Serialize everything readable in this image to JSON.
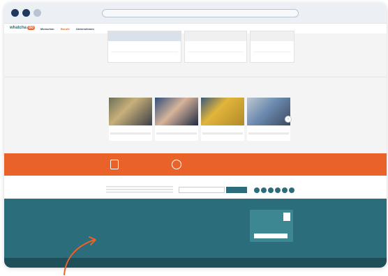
{
  "browser": {
    "url": ""
  },
  "nav": {
    "logo_text": "whatchado",
    "items": [
      "Menschen",
      "Berufe",
      "Unternehmen"
    ],
    "active_index": 1
  },
  "job_cards": [],
  "professions": {
    "title": "",
    "more_label": "",
    "cards": [
      {
        "name": ""
      },
      {
        "name": ""
      },
      {
        "name": ""
      },
      {
        "name": ""
      }
    ]
  },
  "stats": [
    {
      "number": "",
      "text": ""
    },
    {
      "number": "",
      "text": ""
    },
    {
      "number": "",
      "text": ""
    }
  ],
  "newsletter": {
    "title": "",
    "input_placeholder": "",
    "button_label": "",
    "follow_label": ""
  },
  "footer": {},
  "colors": {
    "accent_orange": "#e8622a",
    "teal": "#2b6d7a",
    "navy": "#1f3a5c"
  },
  "icons": [
    "chevron-right-icon",
    "arrow-icon"
  ]
}
